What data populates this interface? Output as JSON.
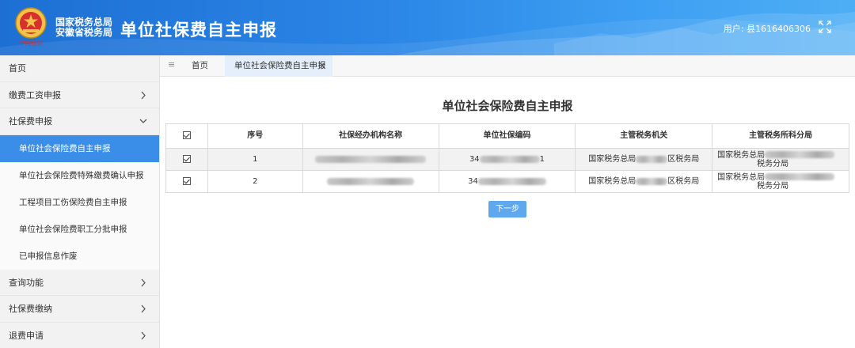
{
  "header": {
    "org_line1": "国家税务总局",
    "org_line2": "安徽省税务局",
    "app_title": "单位社保费自主申报",
    "user_label": "用户: 县1616406306",
    "emblem_caption": "中国税务"
  },
  "sidebar": {
    "items": [
      {
        "label": "首页"
      },
      {
        "label": "缴费工资申报"
      },
      {
        "label": "社保费申报"
      },
      {
        "label": "单位社会保险费自主申报"
      },
      {
        "label": "单位社会保险费特殊缴费确认申报"
      },
      {
        "label": "工程项目工伤保险费自主申报"
      },
      {
        "label": "单位社会保险费职工分批申报"
      },
      {
        "label": "已申报信息作废"
      },
      {
        "label": "查询功能"
      },
      {
        "label": "社保费缴纳"
      },
      {
        "label": "退费申请"
      }
    ]
  },
  "tabs": {
    "home": "首页",
    "active": "单位社会保险费自主申报"
  },
  "main": {
    "heading": "单位社会保险费自主申报",
    "columns": [
      "序号",
      "社保经办机构名称",
      "单位社保编码",
      "主管税务机关",
      "主管税务所科分局"
    ],
    "rows": [
      {
        "no": "1",
        "code_prefix": "34",
        "code_suffix": "1",
        "tax_prefix": "国家税务总局",
        "tax_suffix": "区税务局",
        "bureau_prefix": "国家税务总局",
        "bureau_suffix": "税务分局"
      },
      {
        "no": "2",
        "code_prefix": "34",
        "code_suffix": "",
        "tax_prefix": "国家税务总局",
        "tax_suffix": "区税务局",
        "bureau_prefix": "国家税务总局",
        "bureau_suffix": "税务分局"
      }
    ],
    "next_button": "下一步"
  },
  "colors": {
    "header_blue": "#2b86e6",
    "active_item": "#3b8ee8",
    "button": "#5fa8ee"
  }
}
